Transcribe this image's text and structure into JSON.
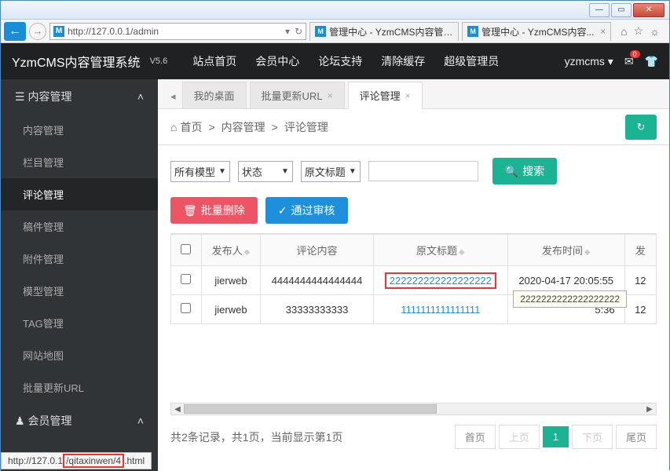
{
  "browser": {
    "url": "http://127.0.0.1/admin",
    "url_icon": "M",
    "tab1": "管理中心 - YzmCMS内容管理...",
    "tab2": "管理中心 - YzmCMS内容...",
    "tab_close": "×"
  },
  "header": {
    "logo": "YzmCMS内容管理系统",
    "version": "V5.6",
    "nav": [
      "站点首页",
      "会员中心",
      "论坛支持",
      "清除缓存",
      "超级管理员"
    ],
    "user": "yzmcms",
    "badge": "0"
  },
  "sidebar": {
    "group1": "内容管理",
    "items1": [
      "内容管理",
      "栏目管理",
      "评论管理",
      "稿件管理",
      "附件管理",
      "模型管理",
      "TAG管理",
      "网站地图",
      "批量更新URL"
    ],
    "group2": "会员管理"
  },
  "tabs": {
    "t1": "我的桌面",
    "t2": "批量更新URL",
    "t3": "评论管理",
    "close": "×",
    "arrow": "◂"
  },
  "breadcrumb": {
    "home": "首页",
    "b1": "内容管理",
    "b2": "评论管理",
    "sep": ">"
  },
  "filter": {
    "sel1": "所有模型",
    "sel2": "状态",
    "sel3": "原文标题",
    "search": "搜索"
  },
  "actions": {
    "del": "批量删除",
    "approve": "通过审核"
  },
  "table": {
    "h1": "发布人",
    "h2": "评论内容",
    "h3": "原文标题",
    "h4": "发布时间",
    "h5": "发",
    "r1c1": "jierweb",
    "r1c2": "4444444444444444",
    "r1c3": "222222222222222222",
    "r1c4": "2020-04-17 20:05:55",
    "r1c5": "12",
    "r2c1": "jierweb",
    "r2c2": "33333333333",
    "r2c3": "1111111111111111",
    "r2c4_partial": "5:36",
    "r2c5": "12",
    "tooltip": "2222222222222222222"
  },
  "pagination": {
    "info": "共2条记录，共1页，当前显示第1页",
    "first": "首页",
    "prev": "上页",
    "page": "1",
    "next": "下页",
    "last": "尾页"
  },
  "statusbar": {
    "prefix": "http://127.0.1",
    "highlight": "/qitaxinwen/4",
    "suffix": ".html"
  }
}
